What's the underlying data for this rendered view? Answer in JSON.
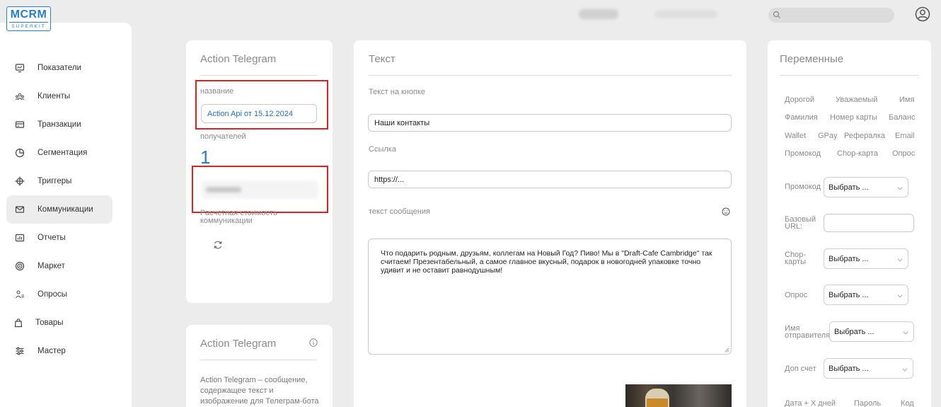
{
  "logo": {
    "line1": "MCRM",
    "line2": "SUPERKIT"
  },
  "header": {
    "search_placeholder": ""
  },
  "sidebar": {
    "items": [
      {
        "label": "Показатели",
        "icon": "monitor-icon"
      },
      {
        "label": "Клиенты",
        "icon": "users-icon"
      },
      {
        "label": "Транзакции",
        "icon": "card-icon"
      },
      {
        "label": "Сегментация",
        "icon": "pie-chart-icon"
      },
      {
        "label": "Триггеры",
        "icon": "crosshair-icon"
      },
      {
        "label": "Коммуникации",
        "icon": "mail-icon",
        "active": true
      },
      {
        "label": "Отчеты",
        "icon": "report-icon"
      },
      {
        "label": "Маркет",
        "icon": "target-icon"
      },
      {
        "label": "Опросы",
        "icon": "survey-icon"
      },
      {
        "label": "Товары",
        "icon": "bag-icon"
      },
      {
        "label": "Мастер",
        "icon": "sliders-icon"
      }
    ]
  },
  "action_card": {
    "title": "Action Telegram",
    "name_label": "название",
    "name_value": "Action Api от 15.12.2024",
    "recipients_label": "получателей",
    "recipients_count": "1",
    "cost_label": "Расчетная стоимость коммуникации"
  },
  "info_card": {
    "title": "Action Telegram",
    "text": "Action Telegram – сообщение, содержащее текст и изображение для Телеграм-бота"
  },
  "text_card": {
    "title": "Текст",
    "button_text_label": "Текст на кнопке",
    "button_text_value": "Наши контакты",
    "link_label": "Ссылка",
    "link_value": "https://...",
    "message_label": "текст сообщения",
    "message_value": "Что подарить родным, друзьям, коллегам на Новый Год? Пиво! Мы в \"Draft-Cafe Cambridge\" так считаем! Презентабельный, а самое главное вкусный, подарок в новогодней упаковке точно удивит и не оставит равнодушным!"
  },
  "vars_card": {
    "title": "Переменные",
    "variables": [
      [
        "Дорогой",
        "Уважаемый",
        "Имя"
      ],
      [
        "Фамилия",
        "Номер карты",
        "Баланс"
      ],
      [
        "Wallet",
        "GPay",
        "Рефералка",
        "Email"
      ],
      [
        "Промокод",
        "Chop-карта",
        "Опрос"
      ]
    ],
    "promo_label": "Промокод",
    "base_url_label": "Базовый URL:",
    "chop_label": "Chop-карты",
    "survey_label": "Опрос",
    "sender_label": "Имя отправителя",
    "extra_label": "Доп счет",
    "select_placeholder": "Выбрать ...",
    "bottom": [
      "Дата + X дней",
      "Пароль",
      "Код"
    ]
  }
}
